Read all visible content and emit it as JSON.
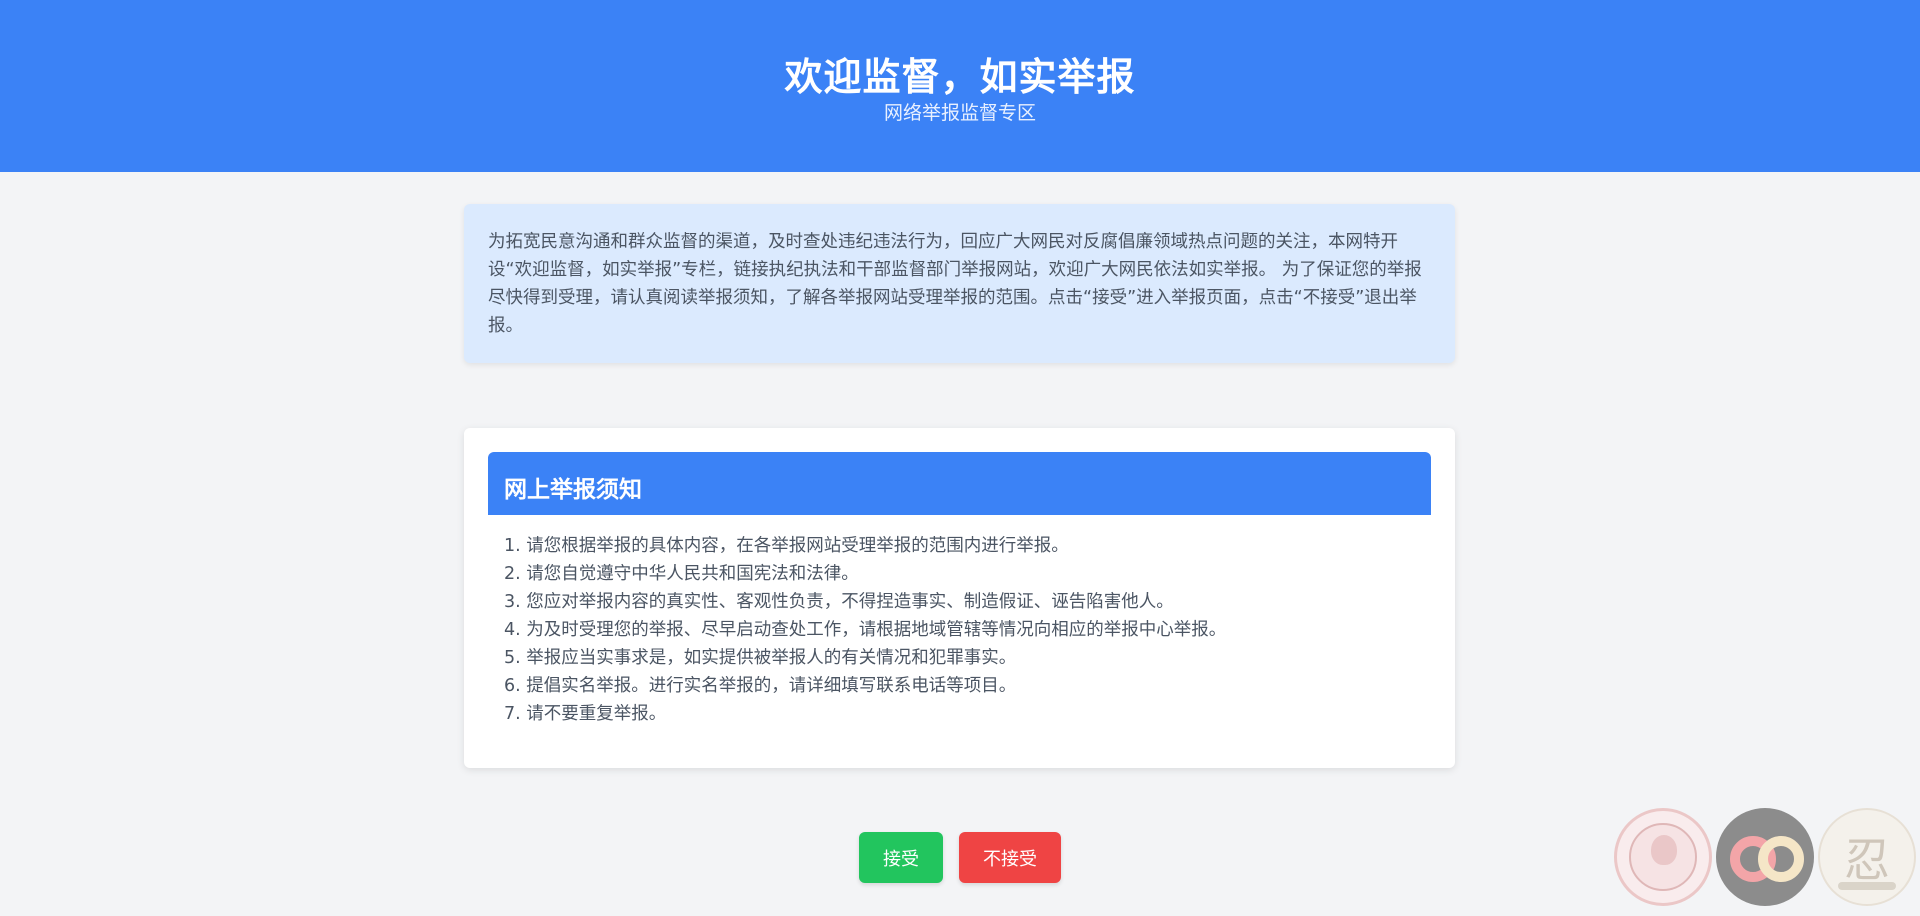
{
  "header": {
    "title": "欢迎监督，如实举报",
    "subtitle": "网络举报监督专区"
  },
  "intro": {
    "text": "为拓宽民意沟通和群众监督的渠道，及时查处违纪违法行为，回应广大网民对反腐倡廉领域热点问题的关注，本网特开设“欢迎监督，如实举报”专栏，链接执纪执法和干部监督部门举报网站，欢迎广大网民依法如实举报。 为了保证您的举报尽快得到受理，请认真阅读举报须知，了解各举报网站受理举报的范围。点击“接受”进入举报页面，点击“不接受”退出举报。"
  },
  "notice": {
    "title": "网上举报须知",
    "items": [
      "1. 请您根据举报的具体内容，在各举报网站受理举报的范围内进行举报。",
      "2. 请您自觉遵守中华人民共和国宪法和法律。",
      "3. 您应对举报内容的真实性、客观性负责，不得捏造事实、制造假证、诬告陷害他人。",
      "4. 为及时受理您的举报、尽早启动查处工作，请根据地域管辖等情况向相应的举报中心举报。",
      "5. 举报应当实事求是，如实提供被举报人的有关情况和犯罪事实。",
      "6. 提倡实名举报。进行实名举报的，请详细填写联系电话等项目。",
      "7. 请不要重复举报。"
    ]
  },
  "buttons": {
    "accept": "接受",
    "reject": "不接受"
  },
  "floating_icons": {
    "seal_icon": "portrait-seal-icon",
    "logo_icon": "brand-rings-icon",
    "calligraphy_icon": "calligraphy-seal-icon",
    "calligraphy_glyph": "忍"
  },
  "colors": {
    "primary": "#3b82f6",
    "accept": "#22c55e",
    "reject": "#ef4444",
    "intro_bg": "#dbeafe"
  }
}
